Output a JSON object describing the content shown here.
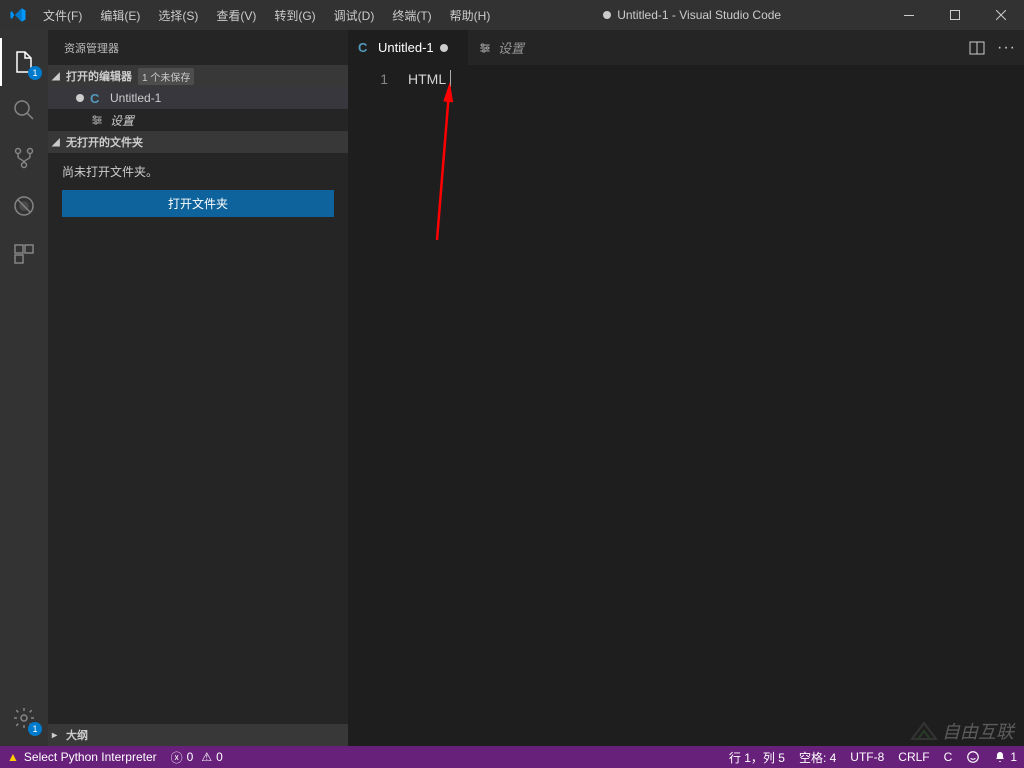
{
  "window": {
    "title": "Untitled-1 - Visual Studio Code",
    "modified": true
  },
  "menu": {
    "file": "文件(F)",
    "edit": "编辑(E)",
    "select": "选择(S)",
    "view": "查看(V)",
    "goto": "转到(G)",
    "debug": "调试(D)",
    "terminal": "终端(T)",
    "help": "帮助(H)"
  },
  "activity": {
    "explorer_badge": "1",
    "settings_badge": "1"
  },
  "sidebar": {
    "title": "资源管理器",
    "openEditors": {
      "label": "打开的编辑器",
      "unsaved_tag": "1 个未保存",
      "items": [
        {
          "name": "Untitled-1",
          "modified": true,
          "icon": "C"
        },
        {
          "name": "设置",
          "modified": false,
          "icon": "settings"
        }
      ]
    },
    "noFolder": {
      "header": "无打开的文件夹",
      "message": "尚未打开文件夹。",
      "button": "打开文件夹"
    },
    "outline": {
      "label": "大纲"
    }
  },
  "tabs": [
    {
      "name": "Untitled-1",
      "icon": "C",
      "modified": true,
      "active": true
    },
    {
      "name": "设置",
      "icon": "settings",
      "modified": false,
      "active": false
    }
  ],
  "editor": {
    "line_number": "1",
    "content": "HTML"
  },
  "statusbar": {
    "select_interpreter": "Select Python Interpreter",
    "errors": "0",
    "warnings": "0",
    "cursor": "行 1，列 5",
    "spaces": "空格: 4",
    "encoding": "UTF-8",
    "eol": "CRLF",
    "language": "C",
    "notifications": "1"
  },
  "watermark": "自由互联"
}
